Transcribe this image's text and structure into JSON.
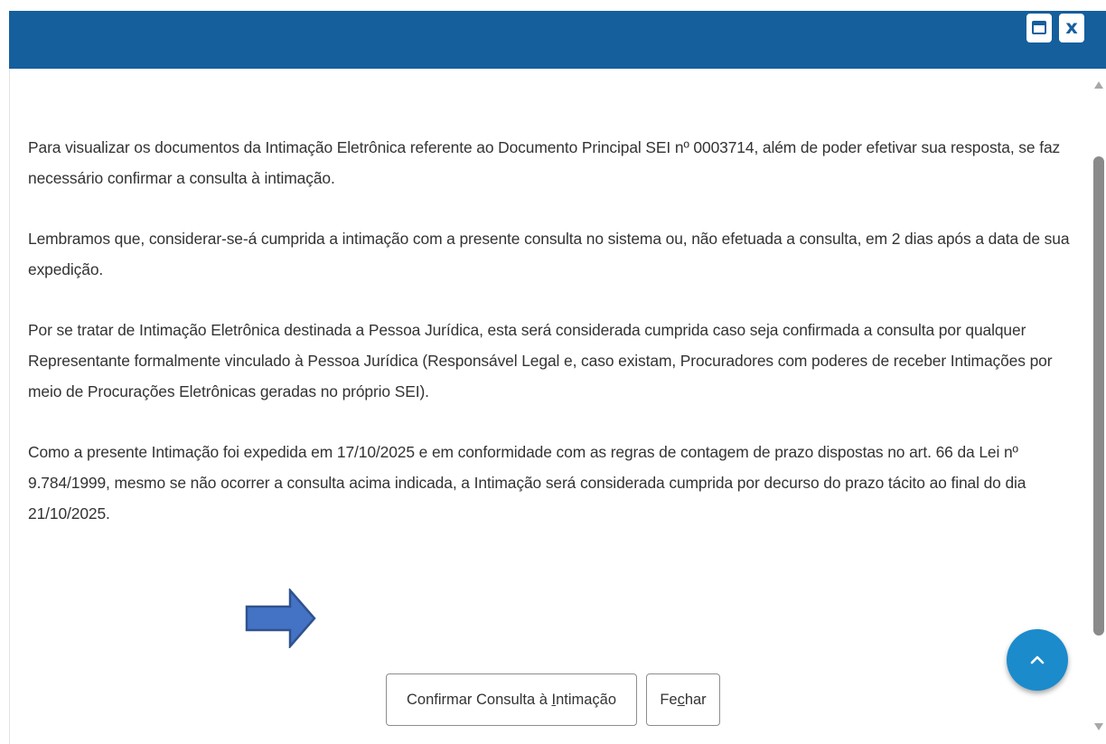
{
  "dialog": {
    "titlebar_color": "#155f9d",
    "buttons": {
      "maximize_icon": "window-maximize-icon",
      "close_icon": "close-icon",
      "close_glyph": "x"
    }
  },
  "content": {
    "paragraphs": [
      "Para visualizar os documentos da Intimação Eletrônica referente ao Documento Principal SEI nº 0003714, além de poder efetivar sua resposta, se faz necessário confirmar a consulta à intimação.",
      "Lembramos que, considerar-se-á cumprida a intimação com a presente consulta no sistema ou, não efetuada a consulta, em 2 dias após a data de sua expedição.",
      "Por se tratar de Intimação Eletrônica destinada a Pessoa Jurídica, esta será considerada cumprida caso seja confirmada a consulta por qualquer Representante formalmente vinculado à Pessoa Jurídica (Responsável Legal e, caso existam, Procuradores com poderes de receber Intimações por meio de Procurações Eletrônicas geradas no próprio SEI).",
      "Como a presente Intimação foi expedida em 17/10/2025 e em conformidade com as regras de contagem de prazo dispostas no art. 66 da Lei nº 9.784/1999, mesmo se não ocorrer a consulta acima indicada, a Intimação será considerada cumprida por decurso do prazo tácito ao final do dia 21/10/2025."
    ]
  },
  "annotation": {
    "arrow_icon": "right-arrow-icon",
    "arrow_color": "#4472c4"
  },
  "actions": {
    "confirm_label_pre": "Confirmar Consulta à ",
    "confirm_label_key": "I",
    "confirm_label_post": "ntimação",
    "close_label_pre": "Fe",
    "close_label_key": "c",
    "close_label_post": "har"
  },
  "fab": {
    "icon": "chevron-up-icon",
    "color": "#1b8bcc"
  }
}
